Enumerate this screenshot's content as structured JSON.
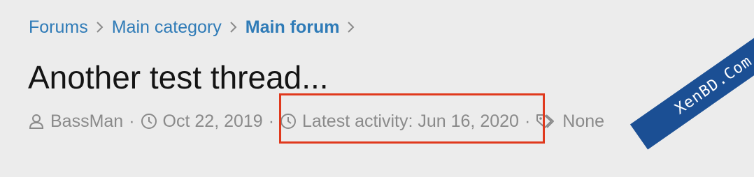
{
  "breadcrumb": {
    "items": [
      {
        "label": "Forums"
      },
      {
        "label": "Main category"
      },
      {
        "label": "Main forum"
      }
    ]
  },
  "thread": {
    "title": "Another test thread...",
    "author": "BassMan",
    "separator": "·",
    "start_date": "Oct 22, 2019",
    "latest_activity": "Latest activity: Jun 16, 2020",
    "tags": "None"
  },
  "icons": {
    "author": "user-icon",
    "date": "clock-icon",
    "activity": "clock-icon",
    "tags": "tags-icon",
    "breadcrumb_separator": "chevron-right-icon"
  },
  "colors": {
    "link": "#2f7bb7",
    "title": "#141414",
    "meta": "#8a8a8a",
    "highlight": "#e0391d",
    "background": "#ececec",
    "watermark": "#1b4f94"
  },
  "watermark": {
    "text": "XenBD.Com"
  }
}
